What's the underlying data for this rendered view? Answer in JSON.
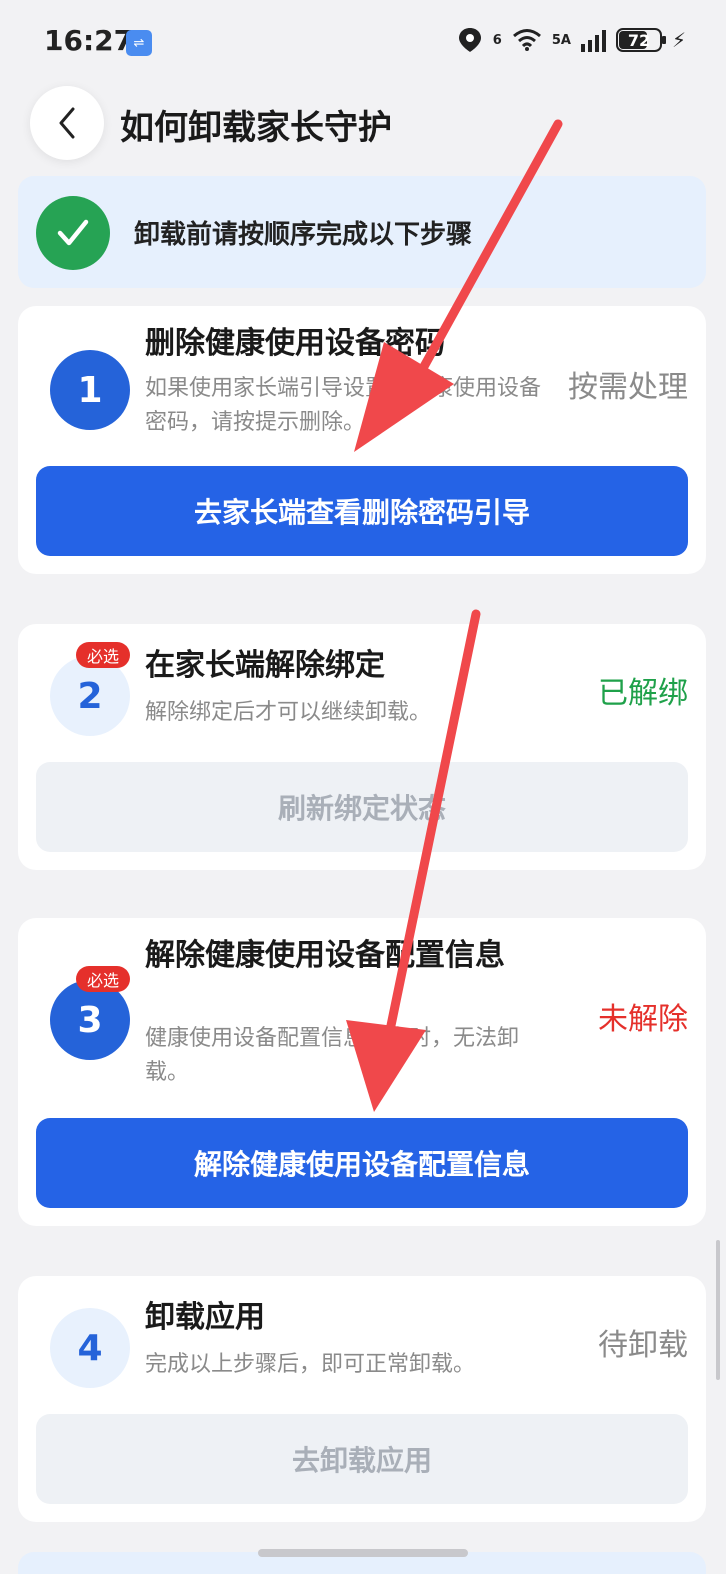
{
  "status_bar": {
    "time": "16:27",
    "usb_icon": "usb-icon",
    "network_label": "6",
    "signal_label": "5A",
    "battery": "72",
    "battery_fraction": 0.72
  },
  "header": {
    "title": "如何卸载家长守护"
  },
  "banner": {
    "text": "卸载前请按顺序完成以下步骤",
    "icon": "check-icon",
    "icon_color": "#26a354"
  },
  "steps": [
    {
      "number": "1",
      "title": "删除健康使用设备密码",
      "description": "如果使用家长端引导设置了健康使用设备密码，请按提示删除。",
      "status": "按需处理",
      "button": "去家长端查看删除密码引导"
    },
    {
      "number": "2",
      "badge": "必选",
      "title": "在家长端解除绑定",
      "description": "解除绑定后才可以继续卸载。",
      "status": "已解绑",
      "button": "刷新绑定状态"
    },
    {
      "number": "3",
      "badge": "必选",
      "title": "解除健康使用设备配置信息",
      "description": "健康使用设备配置信息开启时，无法卸载。",
      "status": "未解除",
      "button": "解除健康使用设备配置信息"
    },
    {
      "number": "4",
      "title": "卸载应用",
      "description": "完成以上步骤后，即可正常卸载。",
      "status": "待卸载",
      "button": "去卸载应用"
    }
  ],
  "colors": {
    "primary": "#2563e6",
    "success": "#1fa14a",
    "danger": "#e5302b",
    "annotation_arrow": "#f0484b"
  }
}
